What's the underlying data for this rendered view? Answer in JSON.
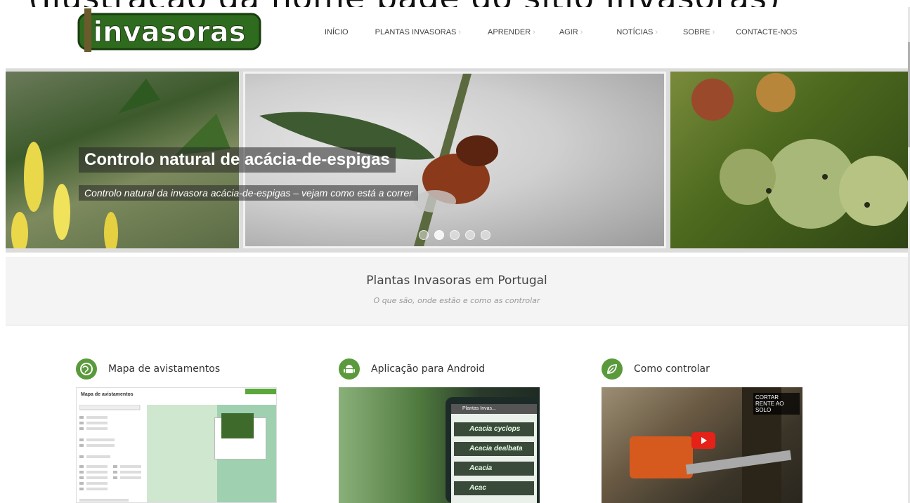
{
  "caption": {
    "text": "(Ilustração da home page do sítio Invasoras)"
  },
  "brand": {
    "logo_text": "invasoras",
    "color": "#2f6b1e"
  },
  "nav": {
    "home": "INÍCIO",
    "plants": "PLANTAS INVASORAS",
    "learn": "APRENDER",
    "act": "AGIR",
    "news": "NOTÍCIAS",
    "about": "SOBRE",
    "contact": "CONTACTE-NOS",
    "chevron": "›"
  },
  "slider": {
    "title": "Controlo natural de acácia-de-espigas",
    "subtitle": "Controlo natural da invasora acácia-de-espigas – vejam como está a correr",
    "dots": 5,
    "active_dot": 2
  },
  "intro": {
    "title": "Plantas Invasoras em Portugal",
    "subtitle": "O que são, onde estão e como as controlar"
  },
  "features": {
    "map": {
      "title": "Mapa de avistamentos",
      "icon": "globe-icon",
      "thumb_title": "Mapa de avistamentos"
    },
    "android": {
      "title": "Aplicação para Android",
      "icon": "android-icon",
      "screen_header": "Plantas Invas...",
      "rows": [
        "Acacia cyclops",
        "Acacia dealbata",
        "Acacia",
        "Acac"
      ]
    },
    "control": {
      "title": "Como controlar",
      "icon": "leaf-icon",
      "video_label": "CORTAR RENTE AO SOLO"
    }
  },
  "colors": {
    "accent": "#5a9a3c",
    "youtube": "#e62117"
  }
}
